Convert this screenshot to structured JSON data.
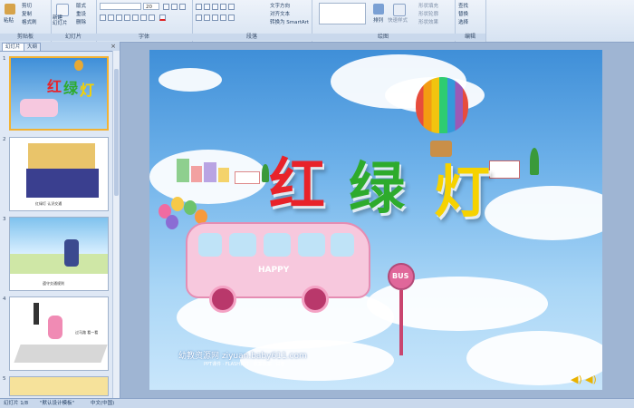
{
  "ribbon": {
    "clipboard": {
      "paste": "粘贴",
      "cut": "剪切",
      "copy": "复制",
      "format_painter": "格式刷",
      "label": "剪贴板"
    },
    "slides": {
      "new_slide": "新建\n幻灯片",
      "layout": "版式",
      "reset": "重设",
      "delete": "删除",
      "label": "幻灯片"
    },
    "font": {
      "font_name": "",
      "font_size": "20",
      "label": "字体"
    },
    "paragraph": {
      "text_direction": "文字方向",
      "align_text": "对齐文本",
      "smartart": "转换为 SmartArt",
      "label": "段落"
    },
    "drawing": {
      "arrange": "排列",
      "quick_styles": "快速样式",
      "shape_fill": "形状填充",
      "shape_outline": "形状轮廓",
      "shape_effects": "形状效果",
      "label": "绘图"
    },
    "editing": {
      "find": "查找",
      "replace": "替换",
      "select": "选择",
      "label": "编辑"
    }
  },
  "panel": {
    "tab_slides": "幻灯片",
    "tab_outline": "大纲",
    "close": "×",
    "thumbnails": [
      {
        "num": "1",
        "caption": ""
      },
      {
        "num": "2",
        "caption": "红绿灯 认识交通"
      },
      {
        "num": "3",
        "caption": "遵守交通规则"
      },
      {
        "num": "4",
        "caption": "过马路 看一看"
      },
      {
        "num": "5",
        "caption": ""
      }
    ]
  },
  "slide": {
    "title_chars": [
      "红",
      "绿",
      "灯"
    ],
    "bus_text": "HAPPY",
    "stop_sign": "BUS",
    "site": "幼教资源网 ziyuan.baby611.com",
    "site_sub": "PPT课件 · FLASH课件 · 教案教案 · 试卷"
  },
  "status": {
    "slide_info": "幻灯片 1/8",
    "theme": "\"默认设计模板\"",
    "language": "中文(中国)"
  },
  "colors": {
    "red": "#e8232a",
    "green": "#2eab2c",
    "yellow": "#f6d200"
  }
}
